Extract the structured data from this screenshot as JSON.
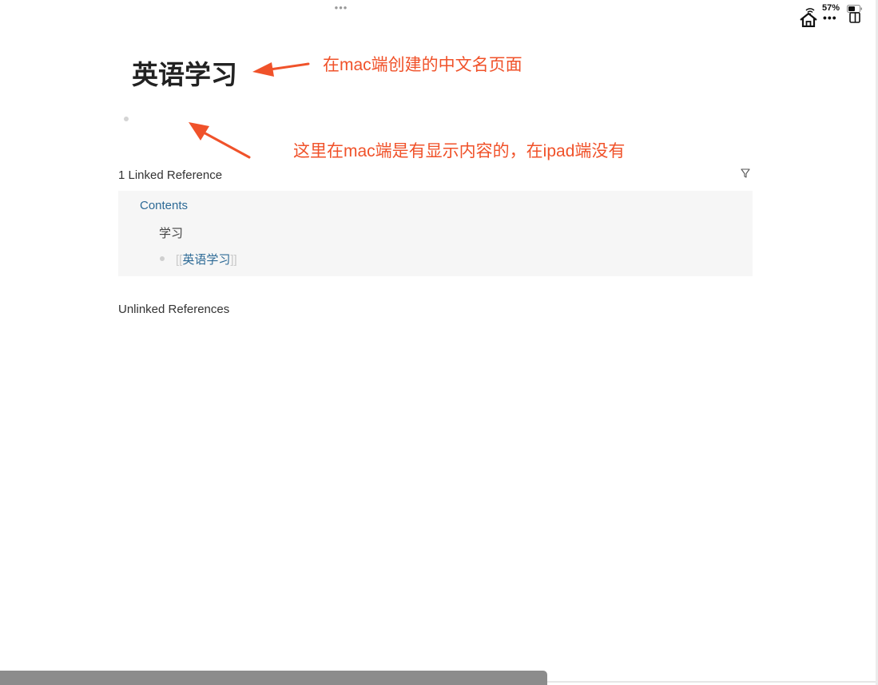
{
  "page": {
    "title": "英语学习"
  },
  "annotations": {
    "title_note": "在mac端创建的中文名页面",
    "content_note": "这里在mac端是有显示内容的，在ipad端没有"
  },
  "status_bar": {
    "battery_percent": "57%",
    "top_dots": "•••",
    "more_dots": "•••"
  },
  "linked_references": {
    "header": "1 Linked Reference",
    "items": [
      {
        "page": "Contents",
        "parent": "学习",
        "block": {
          "open_bracket": "[[",
          "link": "英语学习",
          "close_bracket": "]]"
        }
      }
    ]
  },
  "unlinked_references": {
    "header": "Unlinked References"
  },
  "colors": {
    "annotation": "#f0522a",
    "link": "#2d6a96",
    "panel_bg": "#f6f6f6"
  }
}
